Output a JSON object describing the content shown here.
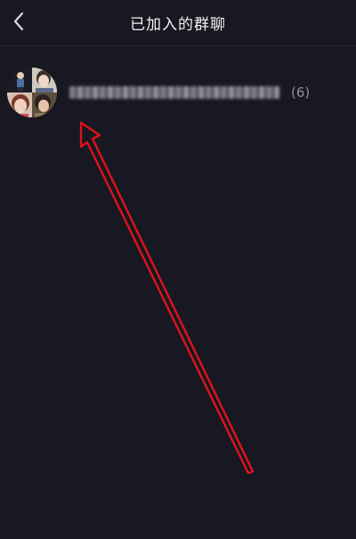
{
  "header": {
    "title": "已加入的群聊",
    "back_icon": "chevron-left-icon"
  },
  "groups": [
    {
      "name": "██████,██████,██████,███...",
      "member_count": "(6)",
      "avatar_count": 4
    }
  ],
  "annotation": {
    "type": "red-arrow",
    "color": "#e0121b"
  },
  "colors": {
    "background": "#171821",
    "text_primary": "#f2f2f2",
    "text_secondary": "#8e8f98"
  }
}
